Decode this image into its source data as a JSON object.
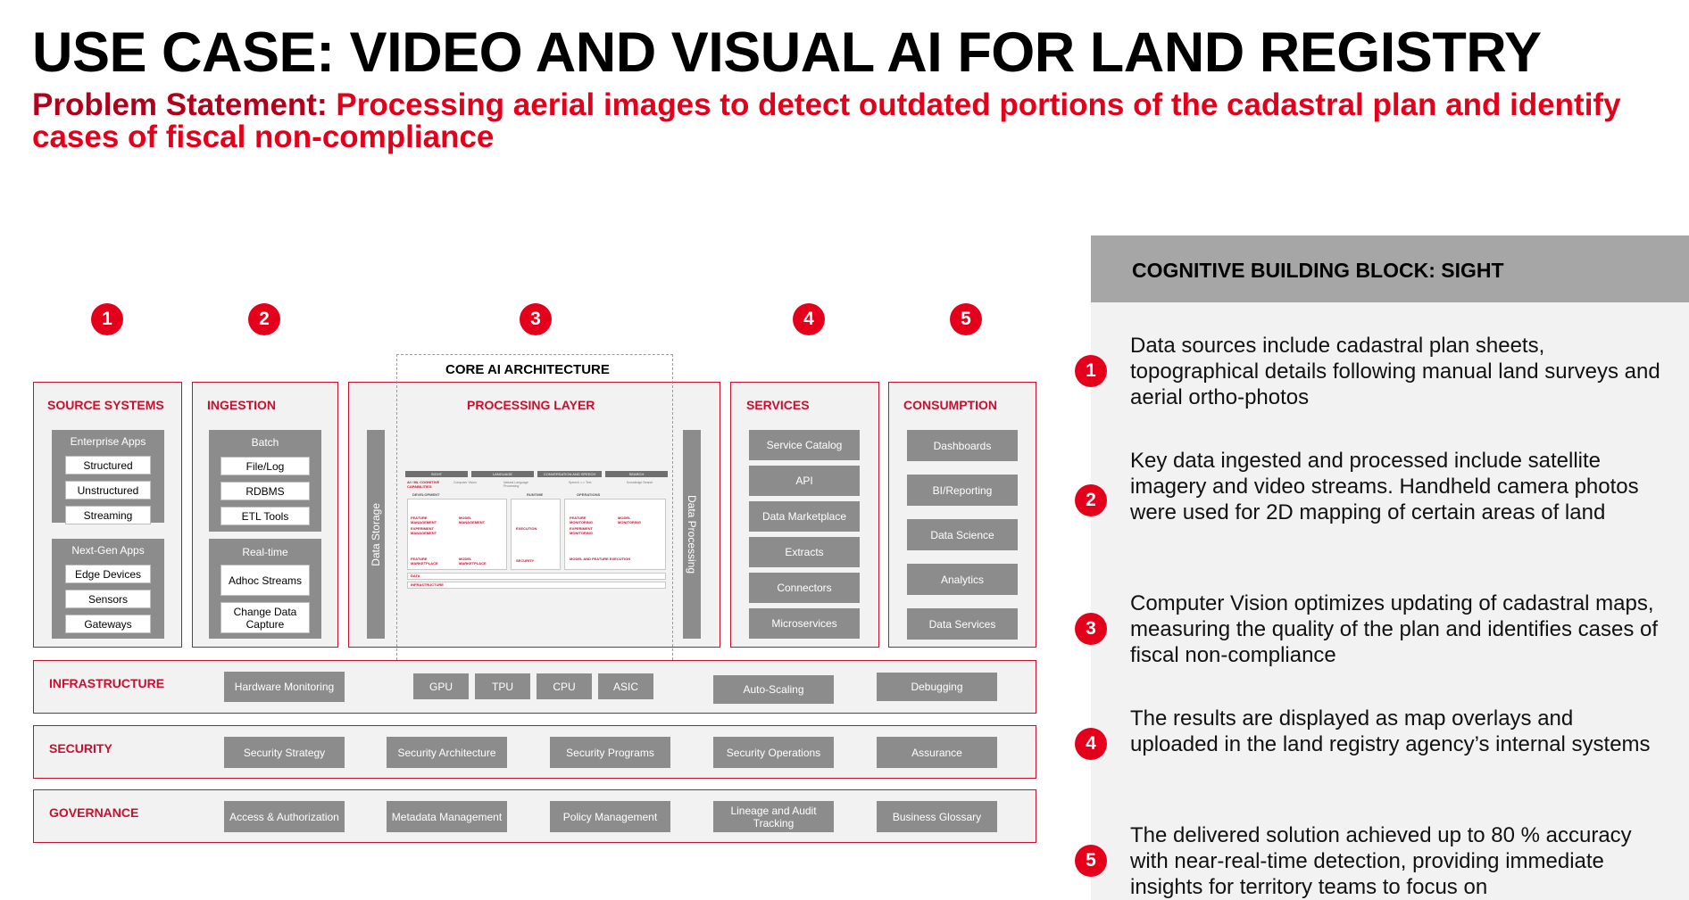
{
  "title": "USE CASE: VIDEO AND VISUAL AI  FOR LAND REGISTRY",
  "problem": {
    "lead": "Problem Statement: ",
    "text": "Processing aerial images to detect outdated portions of the cadastral plan and identify cases of fiscal non-compliance"
  },
  "colors": {
    "accent": "#e4001b",
    "panel_border": "#c8102e",
    "box_gray": "#8c8c8c",
    "sidebar_bg": "#f2f2f2",
    "sidebar_header": "#a6a6a6"
  },
  "badges": [
    "1",
    "2",
    "3",
    "4",
    "5"
  ],
  "source_systems": {
    "title": "SOURCE SYSTEMS",
    "enterprise": {
      "title": "Enterprise Apps",
      "items": [
        "Structured",
        "Unstructured",
        "Streaming"
      ]
    },
    "nextgen": {
      "title": "Next-Gen Apps",
      "items": [
        "Edge Devices",
        "Sensors",
        "Gateways"
      ]
    }
  },
  "ingestion": {
    "title": "INGESTION",
    "batch": {
      "title": "Batch",
      "items": [
        "File/Log",
        "RDBMS",
        "ETL Tools"
      ]
    },
    "realtime": {
      "title": "Real-time",
      "items": [
        "Adhoc Streams",
        "Change Data Capture"
      ]
    }
  },
  "core": {
    "title": "CORE AI ARCHITECTURE",
    "processing_title": "PROCESSING LAYER",
    "data_storage": "Data Storage",
    "data_processing": "Data Processing",
    "mini": {
      "headers": [
        "SIGHT",
        "LANGUAGE",
        "CONVERSATION AND SPEECH",
        "SEARCH"
      ],
      "capabilities": "AI / ML COGNITIVE CAPABILITIES",
      "cap_items": [
        "Computer Vision",
        "Natural Language Processing",
        "Speech <-> Text",
        "Knowledge Search"
      ],
      "sections": [
        "DEVELOPMENT",
        "RUNTIME",
        "OPERATIONS"
      ],
      "dev": [
        "FEATURE MANAGEMENT",
        "MODEL MANAGEMENT",
        "EXPERIMENT MANAGEMENT",
        "FEATURE MARKETPLACE",
        "MODEL MARKETPLACE"
      ],
      "runtime": [
        "EXECUTION",
        "SECURITY"
      ],
      "ops": [
        "FEATURE MONITORING",
        "MODEL MONITORING",
        "EXPERIMENT MONITORING",
        "MODEL AND FEATURE EXECUTION"
      ],
      "data": "DATA",
      "infrastructure": "INFRASTRUCTURE"
    }
  },
  "services": {
    "title": "SERVICES",
    "items": [
      "Service Catalog",
      "API",
      "Data Marketplace",
      "Extracts",
      "Connectors",
      "Microservices"
    ]
  },
  "consumption": {
    "title": "CONSUMPTION",
    "items": [
      "Dashboards",
      "BI/Reporting",
      "Data Science",
      "Analytics",
      "Data Services"
    ]
  },
  "infrastructure": {
    "title": "INFRASTRUCTURE",
    "items": [
      "Hardware Monitoring",
      "GPU",
      "TPU",
      "CPU",
      "ASIC",
      "Auto-Scaling",
      "Debugging"
    ]
  },
  "security": {
    "title": "SECURITY",
    "items": [
      "Security Strategy",
      "Security Architecture",
      "Security Programs",
      "Security Operations",
      "Assurance"
    ]
  },
  "governance": {
    "title": "GOVERNANCE",
    "items": [
      "Access & Authorization",
      "Metadata Management",
      "Policy Management",
      "Lineage and Audit Tracking",
      "Business Glossary"
    ]
  },
  "sidebar": {
    "title": "COGNITIVE BUILDING BLOCK: SIGHT",
    "items": [
      {
        "num": "1",
        "text": "Data sources include cadastral plan sheets, topographical details following manual land surveys and aerial ortho-photos"
      },
      {
        "num": "2",
        "text": "Key data ingested and processed include satellite imagery and video streams. Handheld camera photos were used for 2D mapping of certain areas of land"
      },
      {
        "num": "3",
        "text": "Computer Vision optimizes updating of cadastral maps, measuring the quality of the plan and identifies cases of fiscal non-compliance"
      },
      {
        "num": "4",
        "text": "The results are displayed as map overlays and uploaded in the land registry agency’s internal systems"
      },
      {
        "num": "5",
        "text": "The delivered solution achieved up to 80 % accuracy with near-real-time detection, providing immediate insights for territory teams to focus on"
      }
    ]
  }
}
